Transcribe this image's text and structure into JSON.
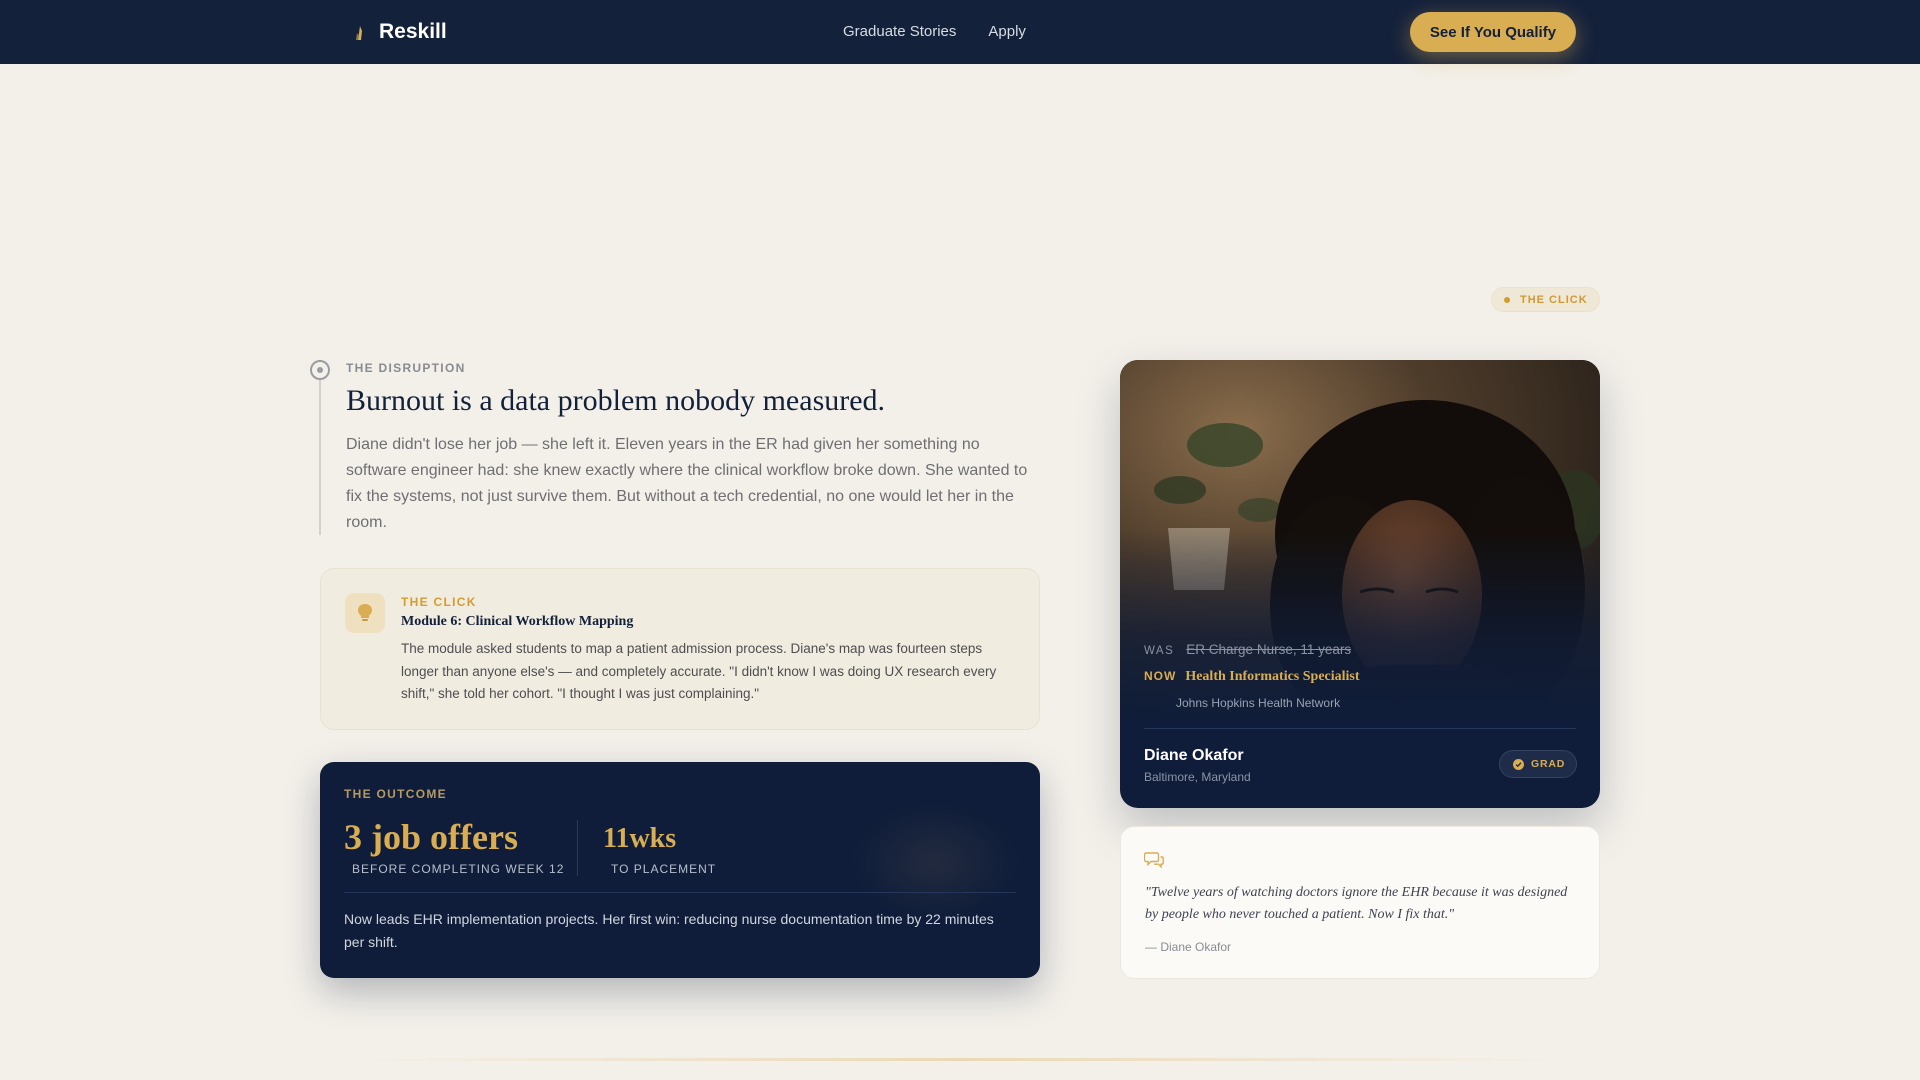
{
  "nav": {
    "brand": "Reskill",
    "links": [
      "Graduate Stories",
      "Apply"
    ],
    "cta": "See If You Qualify"
  },
  "chip": {
    "label": "THE CLICK"
  },
  "disruption": {
    "eyebrow": "THE DISRUPTION",
    "title": "Burnout is a data problem nobody measured.",
    "body": "Diane didn't lose her job — she left it. Eleven years in the ER had given her something no software engineer had: she knew exactly where the clinical workflow broke down. She wanted to fix the systems, not just survive them. But without a tech credential, no one would let her in the room."
  },
  "click": {
    "eyebrow": "THE CLICK",
    "title": "Module 6: Clinical Workflow Mapping",
    "body": "The module asked students to map a patient admission process. Diane's map was fourteen steps longer than anyone else's — and completely accurate. \"I didn't know I was doing UX research every shift,\" she told her cohort. \"I thought I was just complaining.\"",
    "icon": "lightbulb-icon"
  },
  "outcome": {
    "eyebrow": "THE OUTCOME",
    "stat1": {
      "value": "3 job offers",
      "label": "BEFORE COMPLETING WEEK 12"
    },
    "stat2": {
      "value": "11wks",
      "label": "TO PLACEMENT"
    },
    "body": "Now leads EHR implementation projects. Her first win: reducing nurse documentation time by 22 minutes per shift."
  },
  "profile": {
    "was_label": "WAS",
    "was_value": "ER Charge Nurse, 11 years",
    "now_label": "NOW",
    "now_value": "Health Informatics Specialist",
    "employer": "Johns Hopkins Health Network",
    "name": "Diane Okafor",
    "location": "Baltimore, Maryland",
    "badge": "GRAD"
  },
  "quote": {
    "icon": "chat-bubble-icon",
    "text": "\"Twelve years of watching doctors ignore the EHR because it was designed by people who never touched a patient. Now I fix that.\"",
    "attribution": "— Diane Okafor"
  },
  "colors": {
    "navy": "#14213b",
    "gold": "#d9ad52",
    "background": "#f3f0ea"
  }
}
